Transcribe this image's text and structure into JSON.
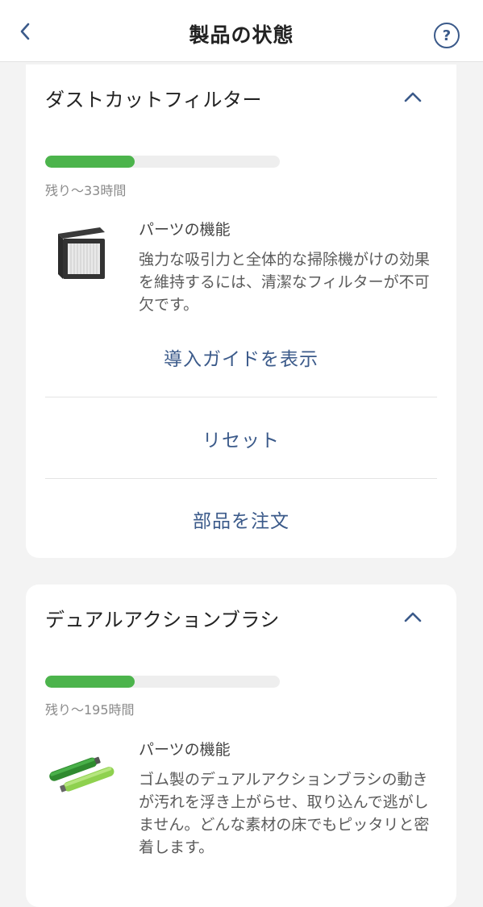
{
  "header": {
    "title": "製品の状態",
    "back_icon": "chevron-left-icon",
    "help_icon": "question-circle-icon",
    "help_glyph": "?"
  },
  "parts": [
    {
      "name": "ダストカットフィルター",
      "remaining_fraction": 0.38,
      "remaining_text": "残り～33時間",
      "function_title": "パーツの機能",
      "function_desc": "強力な吸引力と全体的な掃除機がけの効果を維持するには、清潔なフィルターが不可欠です。",
      "actions": {
        "guide": "導入ガイドを表示",
        "reset": "リセット",
        "order": "部品を注文"
      }
    },
    {
      "name": "デュアルアクションブラシ",
      "remaining_fraction": 0.38,
      "remaining_text": "残り～195時間",
      "function_title": "パーツの機能",
      "function_desc": "ゴム製のデュアルアクションブラシの動きが汚れを浮き上がらせ、取り込んで逃がしません。どんな素材の床でもピッタリと密着します。"
    }
  ],
  "colors": {
    "progress": "#4cb44c",
    "link": "#3b5a8a",
    "background": "#f3f3f3"
  }
}
